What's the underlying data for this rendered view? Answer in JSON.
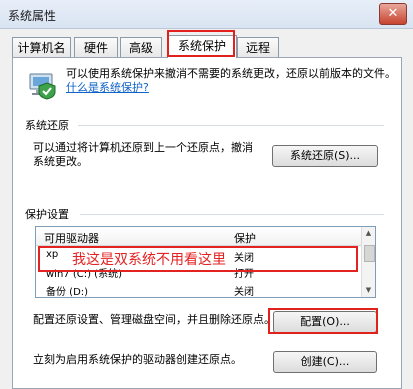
{
  "window": {
    "title": "系统属性",
    "close_label": "✕"
  },
  "tabs": [
    {
      "label": "计算机名"
    },
    {
      "label": "硬件"
    },
    {
      "label": "高级"
    },
    {
      "label": "系统保护"
    },
    {
      "label": "远程"
    }
  ],
  "active_tab": "系统保护",
  "intro": {
    "text": "可以使用系统保护来撤消不需要的系统更改，还原以前版本的文件。",
    "link": "什么是系统保护?"
  },
  "restore": {
    "group_label": "系统还原",
    "description": "可以通过将计算机还原到上一个还原点，撤消系统更改。",
    "button": "系统还原(S)..."
  },
  "protection": {
    "group_label": "保护设置",
    "columns": [
      "可用驱动器",
      "保护"
    ],
    "drives": [
      {
        "name": "xp",
        "status": "关闭"
      },
      {
        "name": "win7 (C:) (系统)",
        "status": "打开"
      },
      {
        "name": "备份 (D:)",
        "status": "关闭"
      }
    ],
    "annotation": "我这是双系统不用看这里"
  },
  "configure": {
    "description": "配置还原设置、管理磁盘空间，并且删除还原点。",
    "button": "配置(O)..."
  },
  "create": {
    "description": "立刻为启用系统保护的驱动器创建还原点。",
    "button": "创建(C)..."
  },
  "colors": {
    "accent": "#0f63c7",
    "highlight": "#e1211e",
    "background": "#f0f0f0"
  }
}
